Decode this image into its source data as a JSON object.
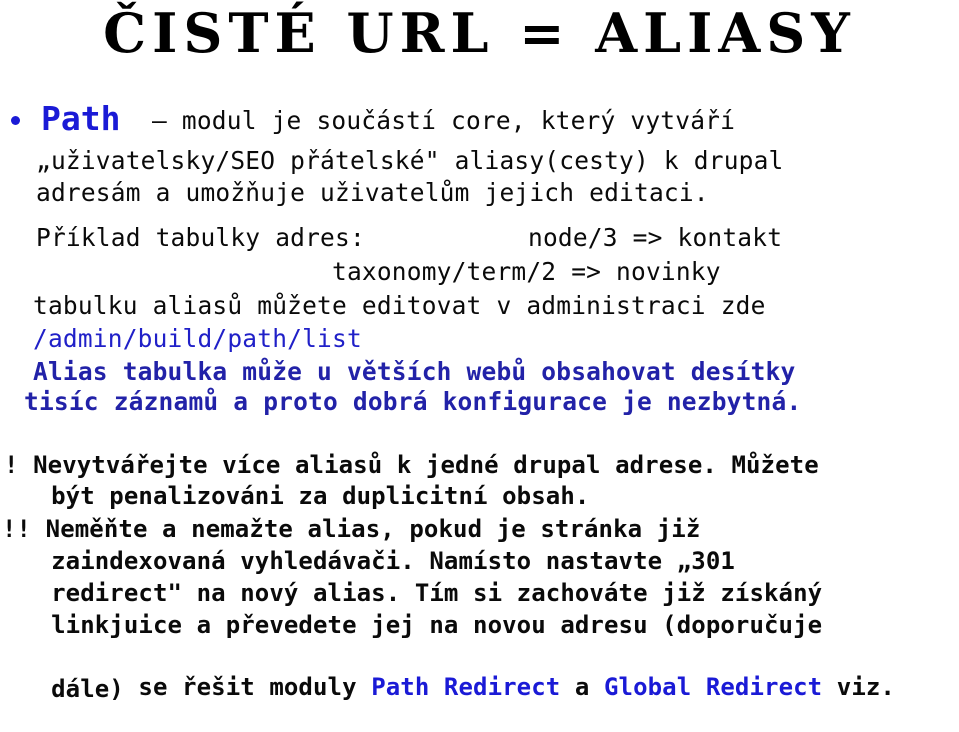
{
  "slide": {
    "title": "ČISTÉ URL = ALIASY",
    "bullet": {
      "icon": "bullet-dot-icon",
      "keyword": "Path",
      "keyword_color": "#1a1ad6",
      "tail": "– modul je součástí core, který vytváří"
    },
    "intro_lines": [
      "„uživatelsky/SEO přátelské\" aliasy(cesty) k drupal",
      "adresám a umožňuje uživatelům jejich editaci."
    ],
    "example": {
      "label": "Příklad tabulky adres:",
      "rows": [
        "node/3 => kontakt",
        "taxonomy/term/2 => novinky"
      ]
    },
    "admin": {
      "text": "tabulku aliasů můžete editovat v administraci zde",
      "path": "/admin/build/path/list",
      "path_color": "#2020c8"
    },
    "note_blue": {
      "color": "#2222a8",
      "lines": [
        "Alias tabulka může u větších webů obsahovat desítky",
        "tisíc záznamů a proto dobrá konfigurace je nezbytná."
      ]
    },
    "warnings": [
      {
        "marker": "!",
        "lines": [
          "! Nevytvářejte více aliasů k jedné drupal adrese. Můžete",
          "  být penalizováni za duplicitní obsah."
        ]
      },
      {
        "marker": "!!",
        "lines": [
          "!! Neměňte a nemažte alias, pokud je stránka již",
          "  zaindexovaná vyhledávači. Namísto nastavte „301",
          "  redirect\" na nový alias. Tím si zachováte již získáný",
          "  linkjuice a převedete jej na novou adresu (doporučuje",
          "  dále)"
        ]
      }
    ],
    "modules_line": {
      "prefix": "  se řešit moduly ",
      "module_1": "Path Redirect",
      "middle": " a ",
      "module_2": "Global Redirect",
      "suffix": " viz.",
      "module_color": "#1a1ad6"
    },
    "last_line": "  dále)"
  }
}
